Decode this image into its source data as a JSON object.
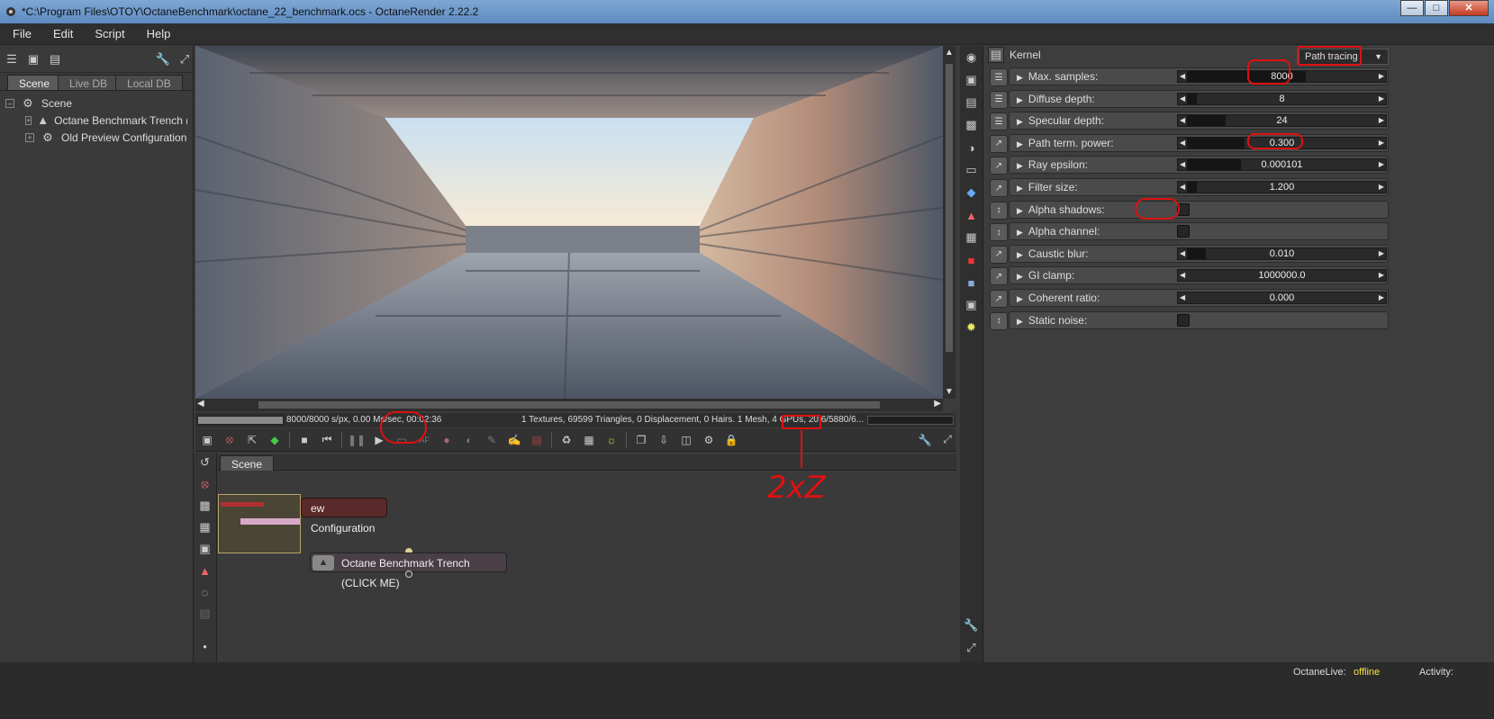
{
  "window": {
    "title": "*C:\\Program Files\\OTOY\\OctaneBenchmark\\octane_22_benchmark.ocs - OctaneRender 2.22.2"
  },
  "menu": [
    "File",
    "Edit",
    "Script",
    "Help"
  ],
  "left": {
    "tabs": [
      "Scene",
      "Live DB",
      "Local DB"
    ],
    "tree": {
      "root": "Scene",
      "items": [
        "Octane Benchmark Trench (CLI",
        "Old Preview Configuration"
      ]
    }
  },
  "render": {
    "stats_left": "8000/8000 s/px, 0.00 Ms/sec, 00:02:36",
    "stats_right": "1 Textures, 69599 Triangles, 0 Displacement, 0 Hairs. 1 Mesh, 4 GPUs, 20.6/5880/6...",
    "progress": 1.0
  },
  "nodegraph": {
    "tab": "Scene",
    "node1_label": "ew Configuration",
    "node2_label": "Octane Benchmark Trench (CLICK ME)"
  },
  "inspector": {
    "header": "Kernel",
    "kernel_type": "Path tracing",
    "params": [
      {
        "label": "Max. samples:",
        "value": "8000",
        "kind": "slider",
        "fill": 0.62
      },
      {
        "label": "Diffuse depth:",
        "value": "8",
        "kind": "slider",
        "fill": 0.05
      },
      {
        "label": "Specular depth:",
        "value": "24",
        "kind": "slider",
        "fill": 0.2
      },
      {
        "label": "Path term. power:",
        "value": "0.300",
        "kind": "slider",
        "fill": 0.3
      },
      {
        "label": "Ray epsilon:",
        "value": "0.000101",
        "kind": "slider",
        "fill": 0.28
      },
      {
        "label": "Filter size:",
        "value": "1.200",
        "kind": "slider",
        "fill": 0.05
      },
      {
        "label": "Alpha shadows:",
        "value": "",
        "kind": "check"
      },
      {
        "label": "Alpha channel:",
        "value": "",
        "kind": "check"
      },
      {
        "label": "Caustic blur:",
        "value": "0.010",
        "kind": "slider",
        "fill": 0.1
      },
      {
        "label": "GI clamp:",
        "value": "1000000.0",
        "kind": "slider",
        "fill": 0.0
      },
      {
        "label": "Coherent ratio:",
        "value": "0.000",
        "kind": "slider",
        "fill": 0.0
      },
      {
        "label": "Static noise:",
        "value": "",
        "kind": "check"
      }
    ]
  },
  "annotation": {
    "text": "2xZ"
  },
  "statusbar": {
    "octanelive_label": "OctaneLive:",
    "octanelive_value": "offline",
    "activity_label": "Activity:"
  }
}
